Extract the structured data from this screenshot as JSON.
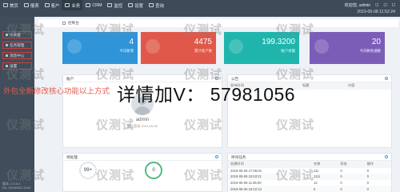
{
  "nav": [
    "首页",
    "报表",
    "客户",
    "业务",
    "CRM",
    "监控",
    "设置",
    "查询"
  ],
  "top": {
    "welcome": "欢迎您, admin",
    "icons": [
      "bell-icon",
      "mail-icon",
      "power-icon"
    ],
    "datetime": "2019-05-08 11:52:24"
  },
  "sidebar": {
    "items": [
      "仪表盘",
      "任务管理",
      "消息中心",
      "设置"
    ],
    "active_item": "仪表盘",
    "footer_line1": "版本: 2.3.4.1",
    "footer_line2": "Db: 20190521 2019"
  },
  "breadcrumb": {
    "current": "控制台"
  },
  "stats": [
    {
      "value": "4",
      "label": "今日新增",
      "color": "#2f95d8"
    },
    {
      "value": "4475",
      "label": "累计客户数",
      "color": "#e0584a"
    },
    {
      "value": "199.3200",
      "label": "账户余额",
      "color": "#1fb5ad"
    },
    {
      "value": "20",
      "label": "今日剩余通数",
      "color": "#7b5db8"
    }
  ],
  "account_panel": {
    "title": "账户",
    "name": "admin",
    "last_login": "最后登录 2019-05-08"
  },
  "notice_panel": {
    "title": "公告",
    "headers": [
      "发布时间",
      "标题",
      "内容"
    ],
    "rows": [
      [
        "2019-05-08",
        "系统通知",
        "..."
      ]
    ]
  },
  "tasks_panel": {
    "title": "待处理",
    "count": "99+",
    "ring2": "0"
  },
  "records_panel": {
    "title": "呼叫任务",
    "headers": [
      "创建时间",
      "名称",
      "状态",
      "操作"
    ],
    "rows": [
      [
        "2019-05-08 17:06:04",
        "111",
        "0",
        "0"
      ],
      [
        "2019-05-08 15:53:21",
        "1111",
        "0",
        "0"
      ],
      [
        "2019-05-08 11:55:00",
        "12",
        "0",
        "0"
      ],
      [
        "2019-05-05 19:22:13",
        "5",
        "0",
        "0"
      ]
    ]
  },
  "overlay": {
    "red_text": "外包全新修改核心功能以上方式",
    "big_text": "详情加V：  57981056"
  },
  "watermark": "仪测试"
}
